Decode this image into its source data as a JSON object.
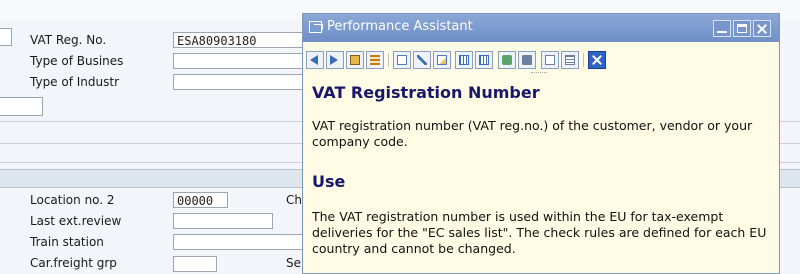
{
  "form": {
    "vat_label": "VAT Reg. No.",
    "vat_value": "ESA80903180",
    "type_business_label": "Type of Busines",
    "type_industry_label": "Type of Industr",
    "location2_label": "Location no. 2",
    "location2_value": "00000",
    "last_review_label": "Last ext.review",
    "train_station_label": "Train station",
    "car_freight_label": "Car.freight grp",
    "check_digit_partial_label": "Ch",
    "se_partial_label": "Se"
  },
  "assistant": {
    "title": "Performance Assistant",
    "toolbar_icons": [
      "back-icon",
      "forward-icon",
      "document-icon",
      "hierarchy-icon",
      "edit-icon",
      "pen-icon",
      "link-icon",
      "table-icon",
      "display-icon",
      "note-icon",
      "print-icon",
      "page-icon",
      "pages-icon",
      "close-doc-icon"
    ],
    "heading1": "VAT Registration Number",
    "para1": "VAT registration number (VAT reg.no.) of the customer, vendor or your company code.",
    "heading2": "Use",
    "para2": "The VAT registration number is used within the EU for tax-exempt deliveries for the \"EC sales list\". The check rules are defined for each EU country and cannot be changed."
  },
  "colors": {
    "title_bar": "#7b9bd0",
    "help_background": "#fffbe4",
    "heading_text": "#18186b",
    "form_background": "#f2f5f9"
  }
}
